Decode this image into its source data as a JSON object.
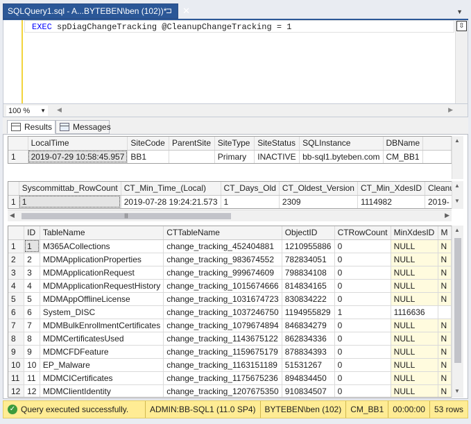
{
  "tab": {
    "title": "SQLQuery1.sql - A...BYTEBEN\\ben (102))*",
    "pin": "⊐",
    "close": "✕"
  },
  "editor": {
    "keyword": "EXEC",
    "code_rest": " spDiagChangeTracking @CleanupChangeTracking = 1"
  },
  "zoom": {
    "value": "100 %"
  },
  "result_tabs": [
    {
      "label": "Results"
    },
    {
      "label": "Messages"
    }
  ],
  "grid1": {
    "columns": [
      "LocalTime",
      "SiteCode",
      "ParentSite",
      "SiteType",
      "SiteStatus",
      "SQLInstance",
      "DBName"
    ],
    "rows": [
      {
        "num": "1",
        "cells": [
          "2019-07-29 10:58:45.957",
          "BB1",
          "",
          "Primary",
          "INACTIVE",
          "bb-sql1.byteben.com",
          "CM_BB1"
        ]
      }
    ]
  },
  "grid2": {
    "columns": [
      "Syscommittab_RowCount",
      "CT_Min_Time_(Local)",
      "CT_Days_Old",
      "CT_Oldest_Version",
      "CT_Min_XdesID",
      "Cleanu"
    ],
    "rows": [
      {
        "num": "1",
        "cells": [
          "1",
          "2019-07-28 19:24:21.573",
          "1",
          "2309",
          "1114982",
          "2019-"
        ]
      }
    ]
  },
  "grid3": {
    "columns": [
      "ID",
      "TableName",
      "CTTableName",
      "ObjectID",
      "CTRowCount",
      "MinXdesID",
      "M"
    ],
    "rows": [
      {
        "num": "1",
        "cells": [
          "1",
          "M365ACollections",
          "change_tracking_452404881",
          "1210955886",
          "0",
          "NULL",
          "N"
        ]
      },
      {
        "num": "2",
        "cells": [
          "2",
          "MDMApplicationProperties",
          "change_tracking_983674552",
          "782834051",
          "0",
          "NULL",
          "N"
        ]
      },
      {
        "num": "3",
        "cells": [
          "3",
          "MDMApplicationRequest",
          "change_tracking_999674609",
          "798834108",
          "0",
          "NULL",
          "N"
        ]
      },
      {
        "num": "4",
        "cells": [
          "4",
          "MDMApplicationRequestHistory",
          "change_tracking_1015674666",
          "814834165",
          "0",
          "NULL",
          "N"
        ]
      },
      {
        "num": "5",
        "cells": [
          "5",
          "MDMAppOfflineLicense",
          "change_tracking_1031674723",
          "830834222",
          "0",
          "NULL",
          "N"
        ]
      },
      {
        "num": "6",
        "cells": [
          "6",
          "System_DISC",
          "change_tracking_1037246750",
          "1194955829",
          "1",
          "1116636",
          ""
        ]
      },
      {
        "num": "7",
        "cells": [
          "7",
          "MDMBulkEnrollmentCertificates",
          "change_tracking_1079674894",
          "846834279",
          "0",
          "NULL",
          "N"
        ]
      },
      {
        "num": "8",
        "cells": [
          "8",
          "MDMCertificatesUsed",
          "change_tracking_1143675122",
          "862834336",
          "0",
          "NULL",
          "N"
        ]
      },
      {
        "num": "9",
        "cells": [
          "9",
          "MDMCFDFeature",
          "change_tracking_1159675179",
          "878834393",
          "0",
          "NULL",
          "N"
        ]
      },
      {
        "num": "10",
        "cells": [
          "10",
          "EP_Malware",
          "change_tracking_1163151189",
          "51531267",
          "0",
          "NULL",
          "N"
        ]
      },
      {
        "num": "11",
        "cells": [
          "11",
          "MDMCICertificates",
          "change_tracking_1175675236",
          "894834450",
          "0",
          "NULL",
          "N"
        ]
      },
      {
        "num": "12",
        "cells": [
          "12",
          "MDMClientIdentity",
          "change_tracking_1207675350",
          "910834507",
          "0",
          "NULL",
          "N"
        ]
      }
    ]
  },
  "status": {
    "message": "Query executed successfully.",
    "server": "ADMIN:BB-SQL1 (11.0 SP4)",
    "user": "BYTEBEN\\ben (102)",
    "database": "CM_BB1",
    "elapsed": "00:00:00",
    "rows": "53 rows"
  },
  "colors": {
    "tab_blue": "#2b5797",
    "status_yellow": "#ffec94",
    "keyword_blue": "#0000ff",
    "null_bg": "#fffbde"
  },
  "icons": [
    "pin-icon",
    "close-icon",
    "split-icon",
    "results-grid-icon",
    "messages-icon",
    "success-check-icon"
  ]
}
